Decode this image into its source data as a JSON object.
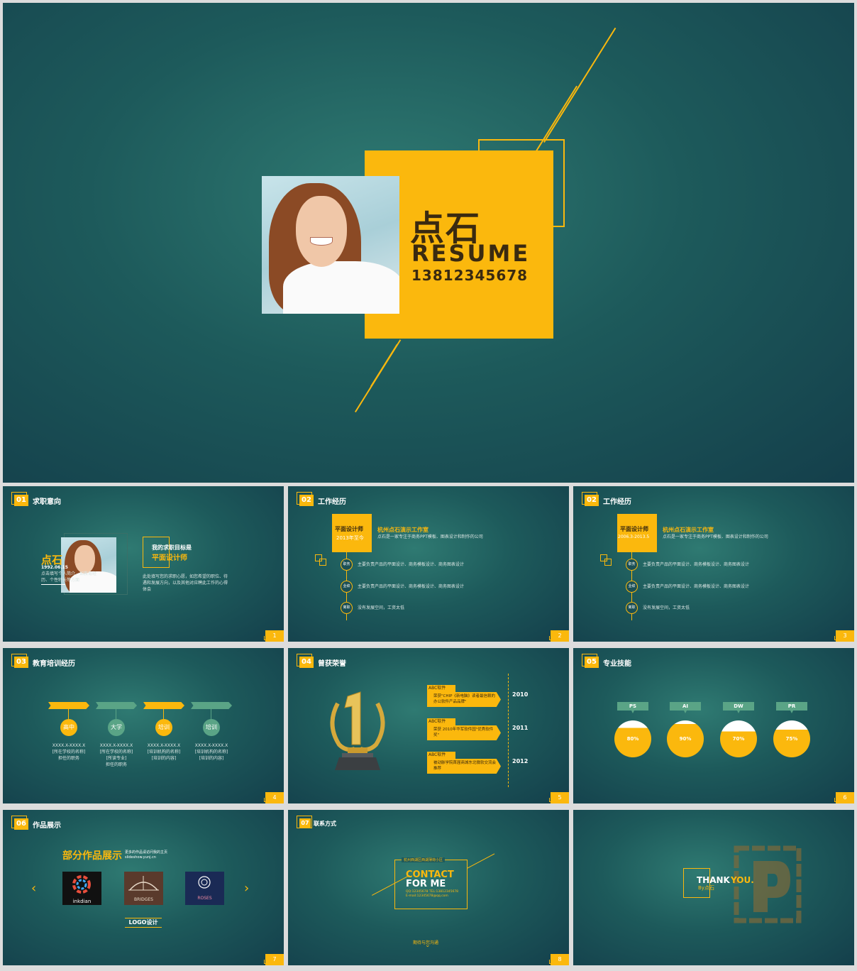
{
  "cover": {
    "name": "点石",
    "resume": "RESUME",
    "phone": "13812345678"
  },
  "s1": {
    "num": "01",
    "title": "求职意向",
    "page": "1",
    "name": "点石",
    "birth": "1992.06.15",
    "intro": "点击填写个人简介，如教育经历、个性特长等方面",
    "goal_label": "我的求职目标是",
    "goal": "平面设计师",
    "goal_desc": "此处填写您的求职心愿，如您希望的职位、待遇和发展方向，以及其他对应聘此工作的心得体会"
  },
  "s2": {
    "num": "02",
    "title": "工作经历",
    "page": "2",
    "role": "平面设计师",
    "period": "2013年至今",
    "company": "杭州点石演示工作室",
    "company_desc": "点石是一家专注于商务PPT模板、图表设计和制作的公司",
    "items": [
      {
        "tag": "职务",
        "text": "主要负责产品的平面设计、商务模板设计、商务图表设计"
      },
      {
        "tag": "业绩",
        "text": "主要负责产品的平面设计、商务模板设计、商务图表设计"
      },
      {
        "tag": "离职",
        "text": "没有发展空间，工资太低"
      }
    ]
  },
  "s3": {
    "num": "02",
    "title": "工作经历",
    "page": "3",
    "role": "平面设计师",
    "period": "2006.3-2013.5",
    "company": "杭州点石演示工作室",
    "company_desc": "点石是一家专注于商务PPT模板、图表设计和制作的公司",
    "items": [
      {
        "tag": "职务",
        "text": "主要负责产品的平面设计、商务模板设计、商务图表设计"
      },
      {
        "tag": "业绩",
        "text": "主要负责产品的平面设计、商务模板设计、商务图表设计"
      },
      {
        "tag": "离职",
        "text": "没有发展空间，工资太低"
      }
    ]
  },
  "s4": {
    "num": "03",
    "title": "教育培训经历",
    "page": "4",
    "stages": [
      {
        "label": "高中",
        "date": "XXXX.X-XXXX.X",
        "lines": [
          "[所在学校的名称]",
          "担任的职务"
        ],
        "color": "#fbb80d"
      },
      {
        "label": "大学",
        "date": "XXXX.X-XXXX.X",
        "lines": [
          "[所在学校的名称]",
          "[所读专业]",
          "担任的职务"
        ],
        "color": "#5aa486"
      },
      {
        "label": "培训",
        "date": "XXXX.X-XXXX.X",
        "lines": [
          "[培训机构的名称]",
          "[培训的内容]"
        ],
        "color": "#fbb80d"
      },
      {
        "label": "培训",
        "date": "XXXX.X-XXXX.X",
        "lines": [
          "[培训机构的名称]",
          "[培训的内容]"
        ],
        "color": "#5aa486"
      }
    ]
  },
  "s5": {
    "num": "04",
    "title": "曾获荣誉",
    "page": "5",
    "awards": [
      {
        "org": "ABC软件",
        "text": "荣获\"CHIP《新电脑》读者最信赖的办公软件产品品牌\"",
        "year": "2010"
      },
      {
        "org": "ABC软件",
        "text": "荣获 2010年华军软件园\"优秀软件奖\"",
        "year": "2011"
      },
      {
        "org": "ABC软件",
        "text": "被动脉学院首届商城东北微软交流会推荐",
        "year": "2012"
      }
    ]
  },
  "s6": {
    "num": "05",
    "title": "专业技能",
    "page": "6",
    "skills": [
      {
        "name": "PS",
        "pct": "80%",
        "value": 0.8
      },
      {
        "name": "AI",
        "pct": "90%",
        "value": 0.9
      },
      {
        "name": "DW",
        "pct": "70%",
        "value": 0.7
      },
      {
        "name": "PR",
        "pct": "75%",
        "value": 0.75
      }
    ]
  },
  "s7": {
    "num": "06",
    "title": "作品展示",
    "page": "7",
    "heading": "部分作品展示",
    "note": "更多的作品请访问我的主页",
    "url": "slideshow.yunj.cn",
    "logos": [
      "inkdian",
      "BRIDGES",
      "ROSES"
    ],
    "caption": "LOGO设计"
  },
  "s8": {
    "num": "07",
    "title": "联系方式",
    "page": "8",
    "address": "杭州西湖区西湖薄荷小区",
    "contact1": "CONTACT",
    "contact2": "FOR ME",
    "qq_tel": "QQ:12345678   TEL:13812345678",
    "email": "E-mail:12345678@qq.com",
    "footer": "期待与您沟通"
  },
  "s9": {
    "thanks_a": "THANK",
    "thanks_b": "YOU.",
    "by": "By点石"
  }
}
